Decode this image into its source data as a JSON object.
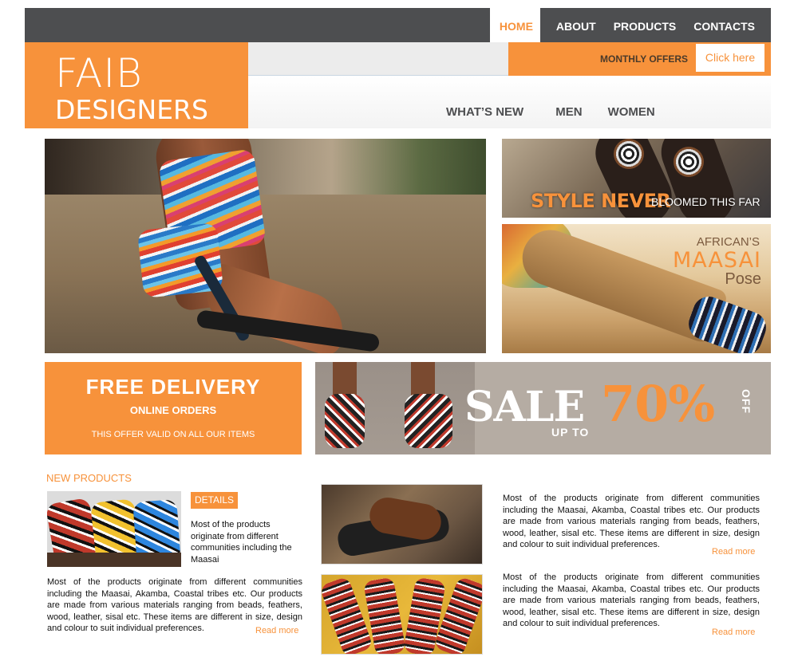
{
  "top_nav": {
    "items": [
      {
        "label": "HOME",
        "active": true
      },
      {
        "label": "ABOUT",
        "active": false
      },
      {
        "label": "PRODUCTS",
        "active": false
      },
      {
        "label": "CONTACTS",
        "active": false
      }
    ]
  },
  "logo": {
    "line1": "FAIB",
    "line2": "DESIGNERS"
  },
  "header": {
    "offer_label": "MONTHLY OFFERS",
    "offer_button": "Click here",
    "sub_nav": [
      "WHAT’S  NEW",
      "MEN",
      "WOMEN"
    ]
  },
  "hero": {
    "side1_highlight": "STYLE NEVER",
    "side1_text": "BLOOMED THIS FAR",
    "side2_line1": "AFRICAN’S",
    "side2_line2": "MAASAI",
    "side2_line3": "Pose"
  },
  "promo": {
    "title": "FREE  DELIVERY",
    "subtitle": "ONLINE ORDERS",
    "note": "THIS OFFER VALID ON ALL OUR  ITEMS"
  },
  "sale": {
    "word": "SALE",
    "upto": "UP TO",
    "percent": "70%",
    "off": "OFF"
  },
  "new_products": {
    "title": "NEW PRODUCTS",
    "details_button": "DETAILS",
    "short_text": "Most of the products originate from different communities including the Maasai",
    "long_text": "Most of the products originate from different communities including the Maasai, Akamba, Coastal tribes etc. Our products are made from various materials ranging from beads, feathers, wood, leather, sisal etc. These items are different in size, design and colour to suit individual preferences.",
    "read_more": "Read more"
  },
  "right_column": [
    {
      "text": "Most of the products originate from different communities including the Maasai, Akamba, Coastal tribes etc. Our products are made from various materials ranging from beads, feathers, wood, leather, sisal etc. These items are different in size, design and colour to suit individual preferences.",
      "read_more": "Read more"
    },
    {
      "text": "Most of the products originate from different communities including the Maasai, Akamba, Coastal tribes etc. Our products are made from various materials ranging from beads, feathers, wood, leather, sisal etc. These items are different in size, design and colour to suit individual preferences.",
      "read_more": "Read more"
    }
  ],
  "colors": {
    "accent": "#f7923b",
    "nav_bg": "#4d4e50",
    "sale_bg": "#b5aca3"
  }
}
